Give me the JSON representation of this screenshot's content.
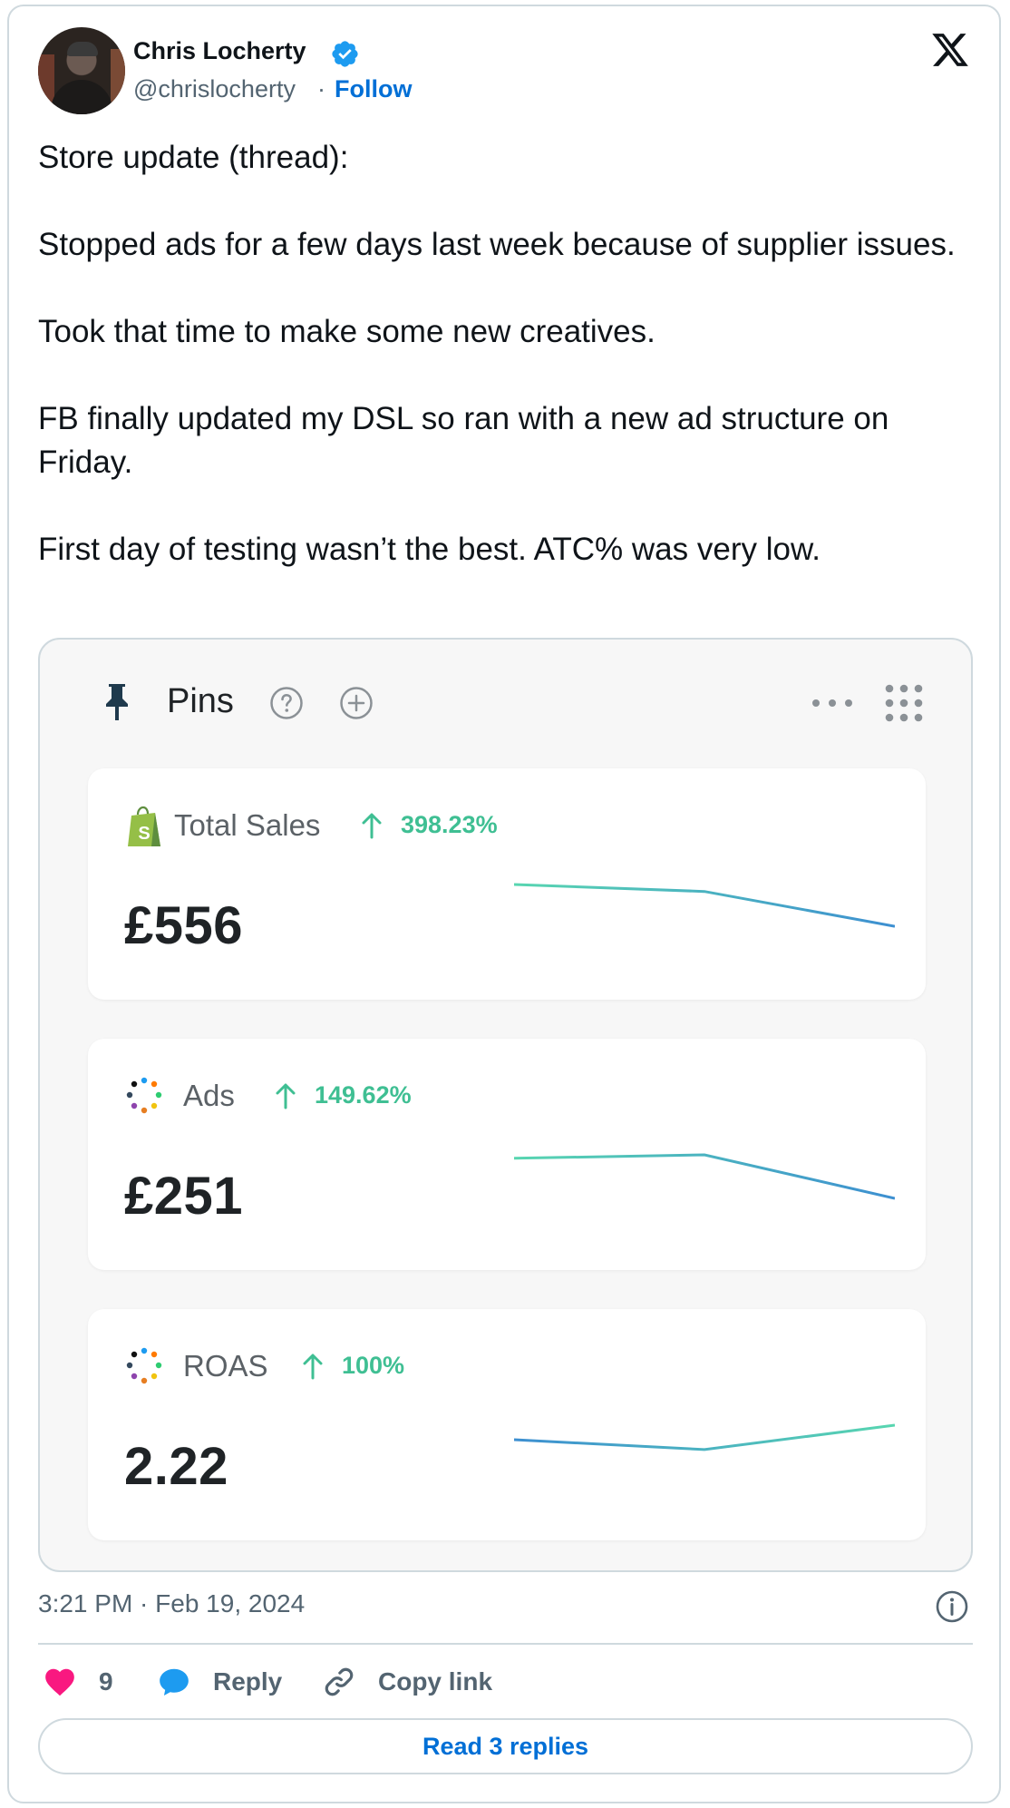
{
  "author": {
    "name": "Chris Locherty",
    "handle": "@chrislocherty",
    "separator": "·",
    "follow_label": "Follow"
  },
  "tweet": {
    "paragraphs": [
      "Store update (thread):",
      "Stopped ads for a few days last week because of supplier issues.",
      "Took that time to make some new creatives.",
      "FB finally updated my DSL so ran with a new ad structure on Friday.",
      "First day of testing wasn’t the best. ATC% was very low."
    ],
    "timestamp": "3:21 PM · Feb 19, 2024"
  },
  "media": {
    "header_title": "Pins",
    "cards": [
      {
        "label": "Total Sales",
        "change": "398.23%",
        "value": "£556",
        "brand_icon": "shopify-bag-icon",
        "trend": [
          0.0,
          0.12,
          0.72
        ]
      },
      {
        "label": "Ads",
        "change": "149.62%",
        "value": "£251",
        "brand_icon": "dotted-ring-icon",
        "trend": [
          0.06,
          0.0,
          0.75
        ]
      },
      {
        "label": "ROAS",
        "change": "100%",
        "value": "2.22",
        "brand_icon": "dotted-ring-icon",
        "trend": [
          0.25,
          0.42,
          0.0
        ]
      }
    ]
  },
  "actions": {
    "like_count": "9",
    "reply_label": "Reply",
    "copy_label": "Copy link",
    "read_replies_label": "Read 3 replies"
  },
  "colors": {
    "accent": "#006fd6",
    "verified": "#1d9bf0",
    "like": "#f91880",
    "positive": "#3fbf93",
    "spark_start": "#58d6b0",
    "spark_end": "#3d8fd1"
  }
}
